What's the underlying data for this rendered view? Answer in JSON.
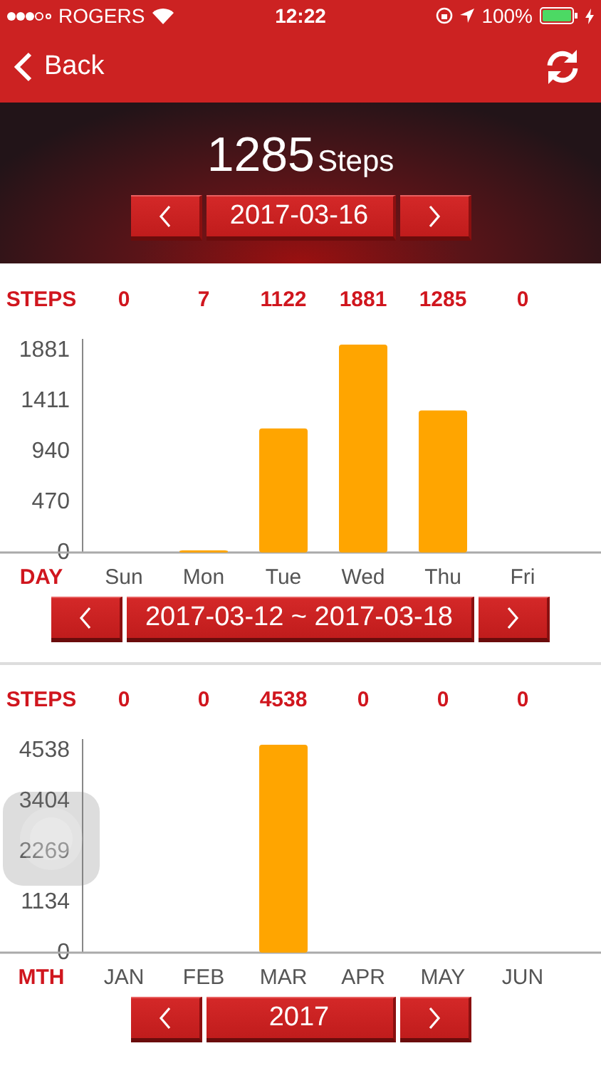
{
  "status_bar": {
    "carrier": "ROGERS",
    "time": "12:22",
    "battery": "100%"
  },
  "nav_bar": {
    "back": "Back"
  },
  "today": {
    "steps": "1285",
    "unit": "Steps",
    "date": "2017-03-16"
  },
  "week": {
    "row_label": "STEPS",
    "axis_label": "DAY",
    "period": "2017-03-12 ~ 2017-03-18",
    "chart_data": {
      "type": "bar",
      "categories": [
        "Sun",
        "Mon",
        "Tue",
        "Wed",
        "Thu",
        "Fri"
      ],
      "values": [
        0,
        7,
        1122,
        1881,
        1285,
        0
      ],
      "ylim": [
        0,
        1881
      ],
      "yticks": [
        0,
        470,
        940,
        1411,
        1881
      ],
      "value_labels": [
        "0",
        "7",
        "1122",
        "1881",
        "1285",
        "0"
      ]
    }
  },
  "month": {
    "row_label": "STEPS",
    "axis_label": "MTH",
    "period": "2017",
    "chart_data": {
      "type": "bar",
      "categories": [
        "JAN",
        "FEB",
        "MAR",
        "APR",
        "MAY",
        "JUN"
      ],
      "values": [
        0,
        0,
        4538,
        0,
        0,
        0
      ],
      "ylim": [
        0,
        4538
      ],
      "yticks": [
        0,
        1134,
        2269,
        3404,
        4538
      ],
      "value_labels": [
        "0",
        "0",
        "4538",
        "0",
        "0",
        "0"
      ]
    }
  }
}
